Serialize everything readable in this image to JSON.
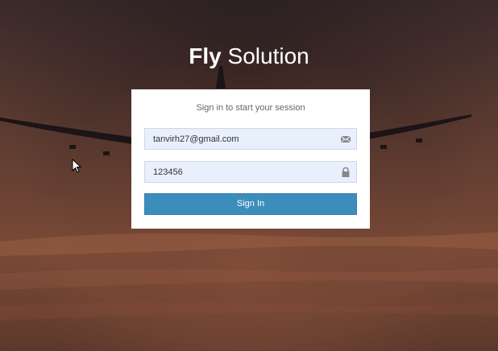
{
  "brand": {
    "strong": "Fly",
    "light": " Solution"
  },
  "login": {
    "message": "Sign in to start your session",
    "email_value": "tanvirh27@gmail.com",
    "password_value": "123456",
    "submit_label": "Sign In"
  },
  "icons": {
    "email": "envelope-icon",
    "password": "lock-icon",
    "cursor": "mouse-pointer-icon"
  },
  "colors": {
    "button": "#3c8dbc",
    "input_fill": "#e8f0fe",
    "box": "#ffffff"
  }
}
